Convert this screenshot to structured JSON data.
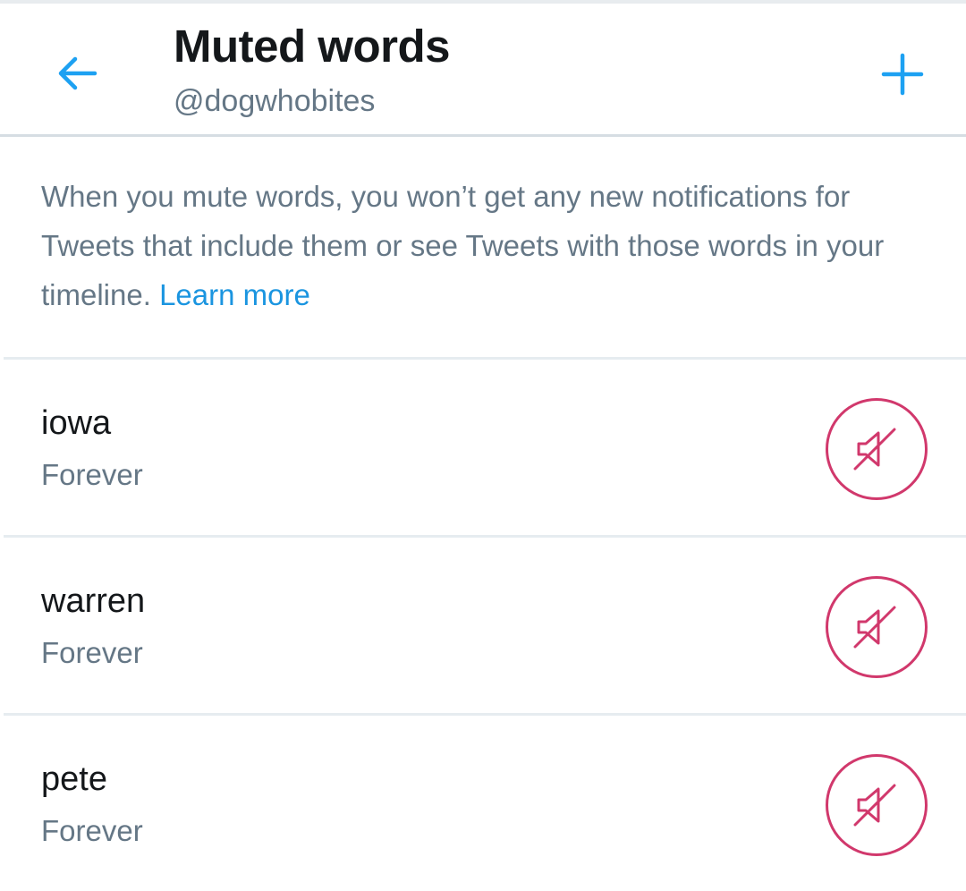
{
  "header": {
    "title": "Muted words",
    "handle": "@dogwhobites",
    "back_icon": "arrow-left-icon",
    "add_icon": "plus-icon",
    "accent_color": "#1da1f2"
  },
  "description": {
    "text": "When you mute words, you won’t get any new notifications for Tweets that include them or see Tweets with those words in your timeline.",
    "link_label": "Learn more"
  },
  "muted_words": [
    {
      "word": "iowa",
      "duration": "Forever"
    },
    {
      "word": "warren",
      "duration": "Forever"
    },
    {
      "word": "pete",
      "duration": "Forever"
    }
  ],
  "unmute_icon": "speaker-muted-icon",
  "unmute_color": "#d1386c"
}
